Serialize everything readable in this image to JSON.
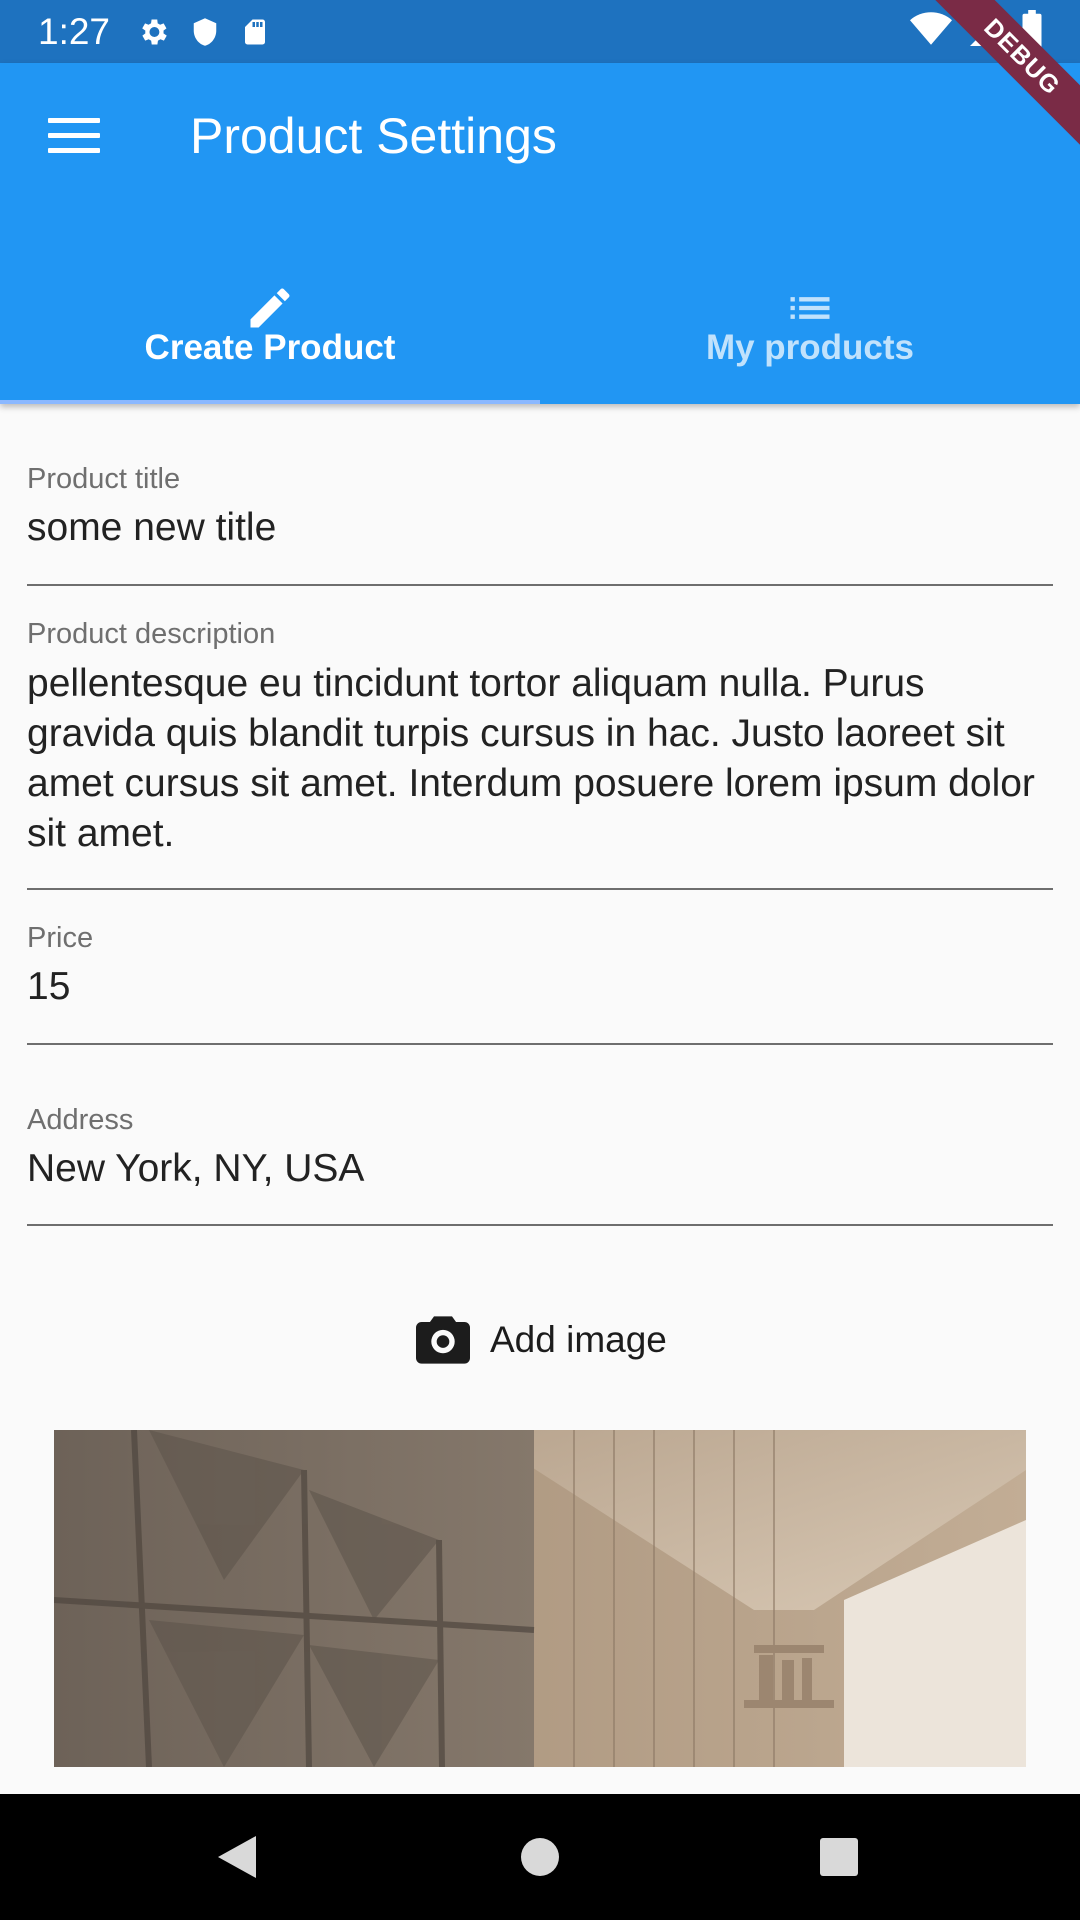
{
  "status_bar": {
    "time": "1:27",
    "left_icons": [
      "gear-icon",
      "shield-icon",
      "sd-card-icon"
    ],
    "right_icons": [
      "wifi-icon",
      "signal-icon",
      "battery-icon"
    ]
  },
  "debug_banner": "DEBUG",
  "app_bar": {
    "title": "Product Settings",
    "menu_icon": "menu-icon",
    "color": "#2196f3"
  },
  "tabs": [
    {
      "label": "Create Product",
      "icon": "pencil-icon",
      "selected": true
    },
    {
      "label": "My products",
      "icon": "list-icon",
      "selected": false
    }
  ],
  "form": {
    "title": {
      "label": "Product title",
      "value": "some new title"
    },
    "description": {
      "label": "Product description",
      "value": "pellentesque eu tincidunt tortor aliquam nulla. Purus gravida quis blandit turpis cursus in hac. Justo laoreet sit amet cursus sit amet. Interdum posuere lorem ipsum dolor sit amet."
    },
    "price": {
      "label": "Price",
      "value": "15"
    },
    "address": {
      "label": "Address",
      "value": "New York, NY, USA"
    }
  },
  "add_image": {
    "label": "Add image",
    "icon": "camera-icon"
  },
  "nav_bar": {
    "buttons": [
      "back-icon",
      "home-icon",
      "recents-icon"
    ]
  }
}
